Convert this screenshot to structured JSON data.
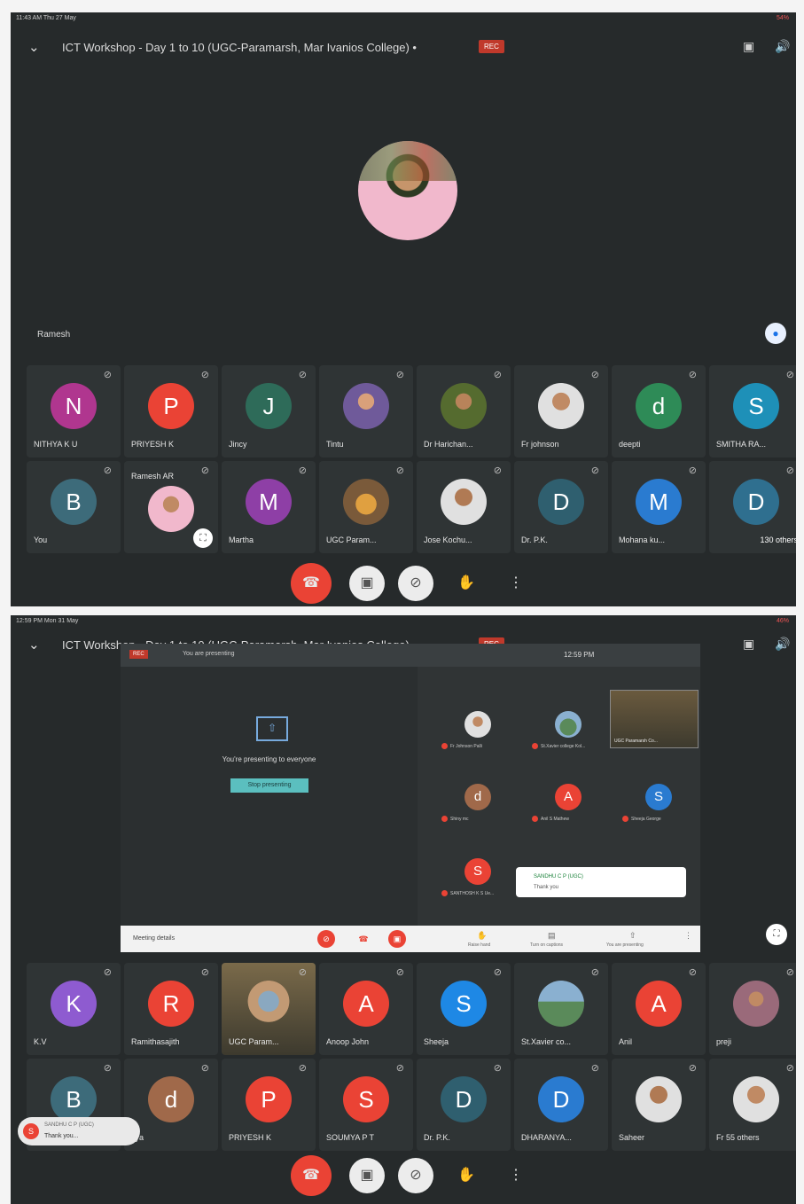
{
  "screens": [
    {
      "status_time": "11:43 AM  Thu 27 May",
      "status_right": "54%",
      "meeting_title": "ICT Workshop - Day 1 to 10 (UGC-Paramarsh, Mar Ivanios College) •",
      "rec_label": "REC",
      "speaker_name": "Ramesh",
      "tiles_row1": [
        {
          "label": "NITHYA K U",
          "letter": "N",
          "color": "#b0368f"
        },
        {
          "label": "PRIYESH K",
          "letter": "P",
          "color": "#ea4335"
        },
        {
          "label": "Jincy",
          "letter": "J",
          "color": "#2e6b59"
        },
        {
          "label": "Tintu",
          "letter": "",
          "color": "#6f5a9a"
        },
        {
          "label": "Dr Harichan...",
          "letter": "",
          "color": "#556b2f"
        },
        {
          "label": "Fr johnson",
          "letter": "",
          "color": "#cfcfcf"
        },
        {
          "label": "deepti",
          "letter": "d",
          "color": "#2e8b57"
        },
        {
          "label": "SMITHA RA...",
          "letter": "S",
          "color": "#1e90b8"
        }
      ],
      "tiles_row2": [
        {
          "label": "You",
          "letter": "B",
          "color": "#3d6b7a"
        },
        {
          "label": "Ramesh AR",
          "letter": "",
          "color": "#a58a6a"
        },
        {
          "label": "Martha",
          "letter": "M",
          "color": "#8e3fa6"
        },
        {
          "label": "UGC Param...",
          "letter": "",
          "color": "#7a5a3a"
        },
        {
          "label": "Jose Kochu...",
          "letter": "",
          "color": "#cfcfcf"
        },
        {
          "label": "Dr. P.K.",
          "letter": "D",
          "color": "#2f5f6f"
        },
        {
          "label": "Mohana ku...",
          "letter": "M",
          "color": "#2a7bd0"
        },
        {
          "label": "130 others",
          "letter": "D",
          "color": "#2f6f8f"
        }
      ]
    },
    {
      "status_time": "12:59 PM  Mon 31 May",
      "status_right": "46%",
      "meeting_title": "ICT Workshop - Day 1 to 10 (UGC-Paramarsh, Mar Ivanios College) •",
      "rec_label": "REC",
      "inner": {
        "rec": "REC",
        "presenting_top": "You are presenting",
        "clock": "12:59 PM",
        "presenting_text": "You're presenting to everyone",
        "stop_button": "Stop presenting",
        "meeting_details": "Meeting details",
        "raise_hand": "Raise hand",
        "captions": "Turn on captions",
        "you_presenting": "You are presenting",
        "notif_name": "SANDHU C P (UGC)",
        "notif_msg": "Thank you",
        "small_tiles": [
          {
            "label": "Fr Johnson Palli",
            "letter": "",
            "color": "#cfcfcf"
          },
          {
            "label": "St.Xavier college Kol...",
            "letter": "",
            "color": "#5a8a5a"
          },
          {
            "label": "Shiny mc",
            "letter": "d",
            "color": "#a0694a"
          },
          {
            "label": "Anil S Mathew",
            "letter": "A",
            "color": "#ea4335"
          },
          {
            "label": "Sheeja George",
            "letter": "S",
            "color": "#2a7bd0"
          },
          {
            "label": "SANTHOSH K S Ue...",
            "letter": "S",
            "color": "#ea4335"
          }
        ],
        "video_label": "UGC Paramarsh Co..."
      },
      "tiles_row1": [
        {
          "label": "K.V",
          "letter": "K",
          "color": "#8e5bd0"
        },
        {
          "label": "Ramithasajith",
          "letter": "R",
          "color": "#ea4335"
        },
        {
          "label": "UGC Param...",
          "letter": "",
          "color": "#7a6a4a"
        },
        {
          "label": "Anoop John",
          "letter": "A",
          "color": "#ea4335"
        },
        {
          "label": "Sheeja",
          "letter": "S",
          "color": "#1e88e5"
        },
        {
          "label": "St.Xavier co...",
          "letter": "",
          "color": "#5a8a5a"
        },
        {
          "label": "Anil",
          "letter": "A",
          "color": "#ea4335"
        },
        {
          "label": "preji",
          "letter": "",
          "color": "#9a6a7a"
        }
      ],
      "tiles_row2": [
        {
          "label": "",
          "letter": "B",
          "color": "#3d6b7a"
        },
        {
          "label": "vya",
          "letter": "d",
          "color": "#a0694a"
        },
        {
          "label": "PRIYESH K",
          "letter": "P",
          "color": "#ea4335"
        },
        {
          "label": "SOUMYA P T",
          "letter": "S",
          "color": "#ea4335"
        },
        {
          "label": "Dr. P.K.",
          "letter": "D",
          "color": "#2f5f6f"
        },
        {
          "label": "DHARANYA...",
          "letter": "D",
          "color": "#2a7bd0"
        },
        {
          "label": "Saheer",
          "letter": "",
          "color": "#cfcfcf"
        },
        {
          "label": "Fr  55 others",
          "letter": "",
          "color": "#cfcfcf"
        }
      ],
      "chat_toast": {
        "name": "SANDHU C P (UGC)",
        "msg": "Thank you...",
        "letter": "S"
      }
    }
  ]
}
